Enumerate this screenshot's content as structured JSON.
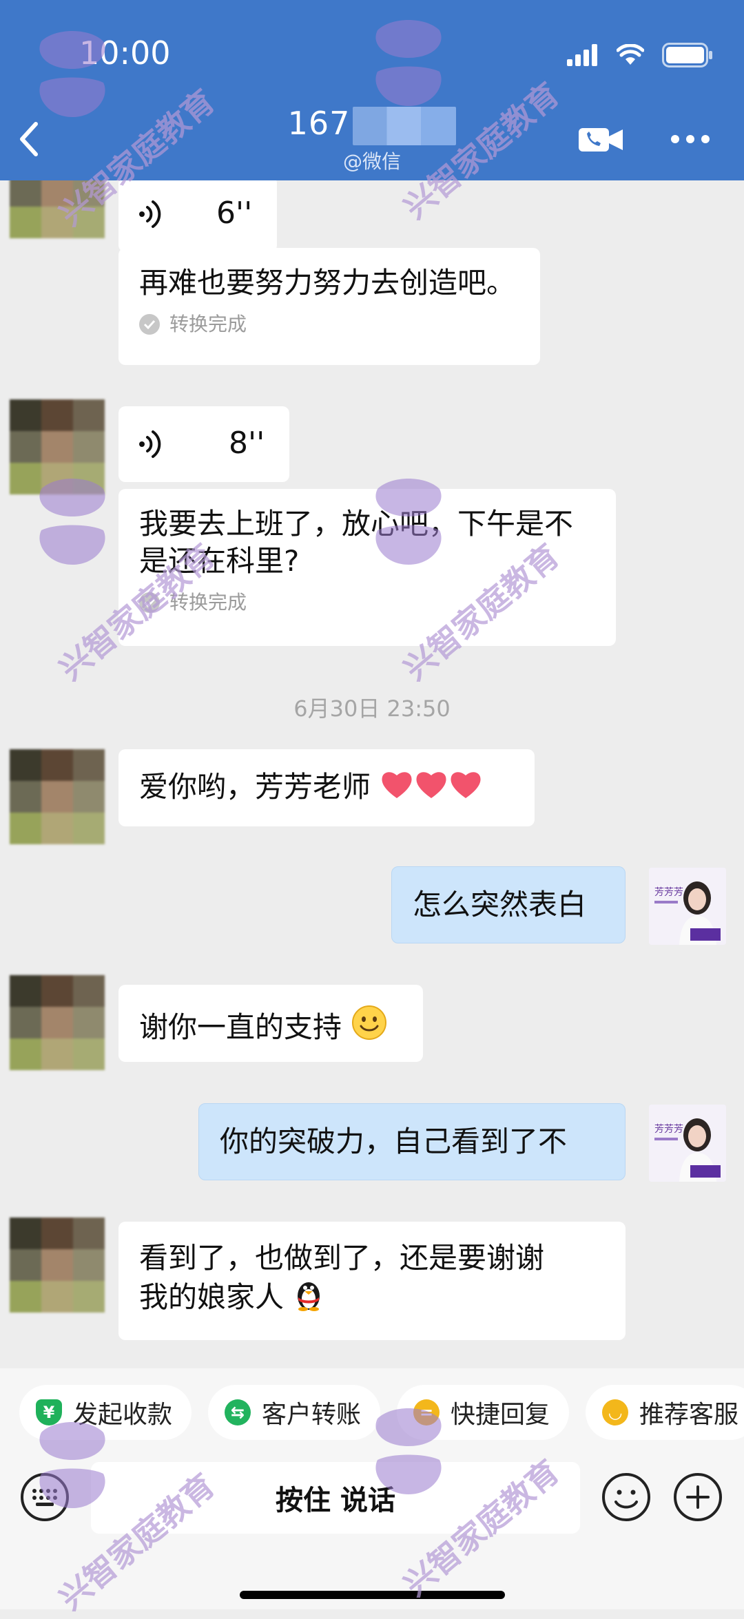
{
  "status": {
    "time": "10:00"
  },
  "header": {
    "title": "167",
    "subtitle": "@微信"
  },
  "messages": [
    {
      "voice_duration": "6''",
      "text": "再难也要努力努力去创造吧。",
      "note": "转换完成"
    },
    {
      "voice_duration": "8''",
      "text_line1": "我要去上班了，放心吧，下午是不",
      "text_line2": "是还在科里?",
      "note": "转换完成"
    },
    {
      "timestamp": "6月30日 23:50"
    },
    {
      "text": "爱你哟，芳芳老师"
    },
    {
      "text": "怎么突然表白"
    },
    {
      "text": "谢你一直的支持"
    },
    {
      "text": "你的突破力，自己看到了不"
    },
    {
      "text_line1": "看到了，也做到了，还是要谢谢",
      "text_line2": "我的娘家人"
    }
  ],
  "my_avatar": {
    "name": "芳芳芳"
  },
  "quick_actions": [
    {
      "label": "发起收款",
      "icon": "yen-shield-icon",
      "color": "#1fb15a"
    },
    {
      "label": "客户转账",
      "icon": "transfer-icon",
      "color": "#22b35e"
    },
    {
      "label": "快捷回复",
      "icon": "quick-reply-icon",
      "color": "#f3b71b"
    },
    {
      "label": "推荐客服",
      "icon": "recommend-icon",
      "color": "#f3b71b"
    }
  ],
  "input": {
    "hold_to_talk": "按住 说话"
  },
  "watermark": {
    "text": "兴智家庭教育"
  },
  "colors": {
    "header": "#3f78c9",
    "my_bubble": "#cde5fb",
    "background": "#ededed"
  }
}
